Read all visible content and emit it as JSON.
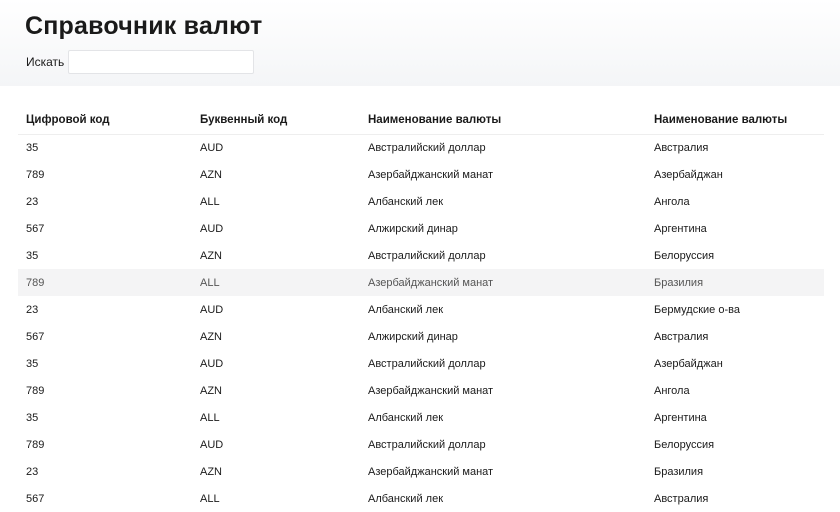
{
  "page": {
    "title": "Справочник валют"
  },
  "search": {
    "label": "Искать",
    "value": "",
    "placeholder": ""
  },
  "table": {
    "headers": [
      "Цифровой код",
      "Буквенный код",
      "Наименование валюты",
      "Наименование валюты"
    ],
    "highlighted_row": 5,
    "rows": [
      [
        "35",
        "AUD",
        "Австралийский доллар",
        "Австралия"
      ],
      [
        "789",
        "AZN",
        "Азербайджанский манат",
        "Азербайджан"
      ],
      [
        "23",
        "ALL",
        "Албанский лек",
        "Ангола"
      ],
      [
        "567",
        "AUD",
        "Алжирский динар",
        "Аргентина"
      ],
      [
        "35",
        "AZN",
        "Австралийский доллар",
        "Белоруссия"
      ],
      [
        "789",
        "ALL",
        "Азербайджанский манат",
        "Бразилия"
      ],
      [
        "23",
        "AUD",
        "Албанский лек",
        "Бермудские о-ва"
      ],
      [
        "567",
        "AZN",
        "Алжирский динар",
        "Австралия"
      ],
      [
        "35",
        "AUD",
        "Австралийский доллар",
        "Азербайджан"
      ],
      [
        "789",
        "AZN",
        "Азербайджанский манат",
        "Ангола"
      ],
      [
        "35",
        "ALL",
        "Албанский лек",
        "Аргентина"
      ],
      [
        "789",
        "AUD",
        "Австралийский доллар",
        "Белоруссия"
      ],
      [
        "23",
        "AZN",
        "Азербайджанский манат",
        "Бразилия"
      ],
      [
        "567",
        "ALL",
        "Албанский лек",
        "Австралия"
      ]
    ]
  }
}
